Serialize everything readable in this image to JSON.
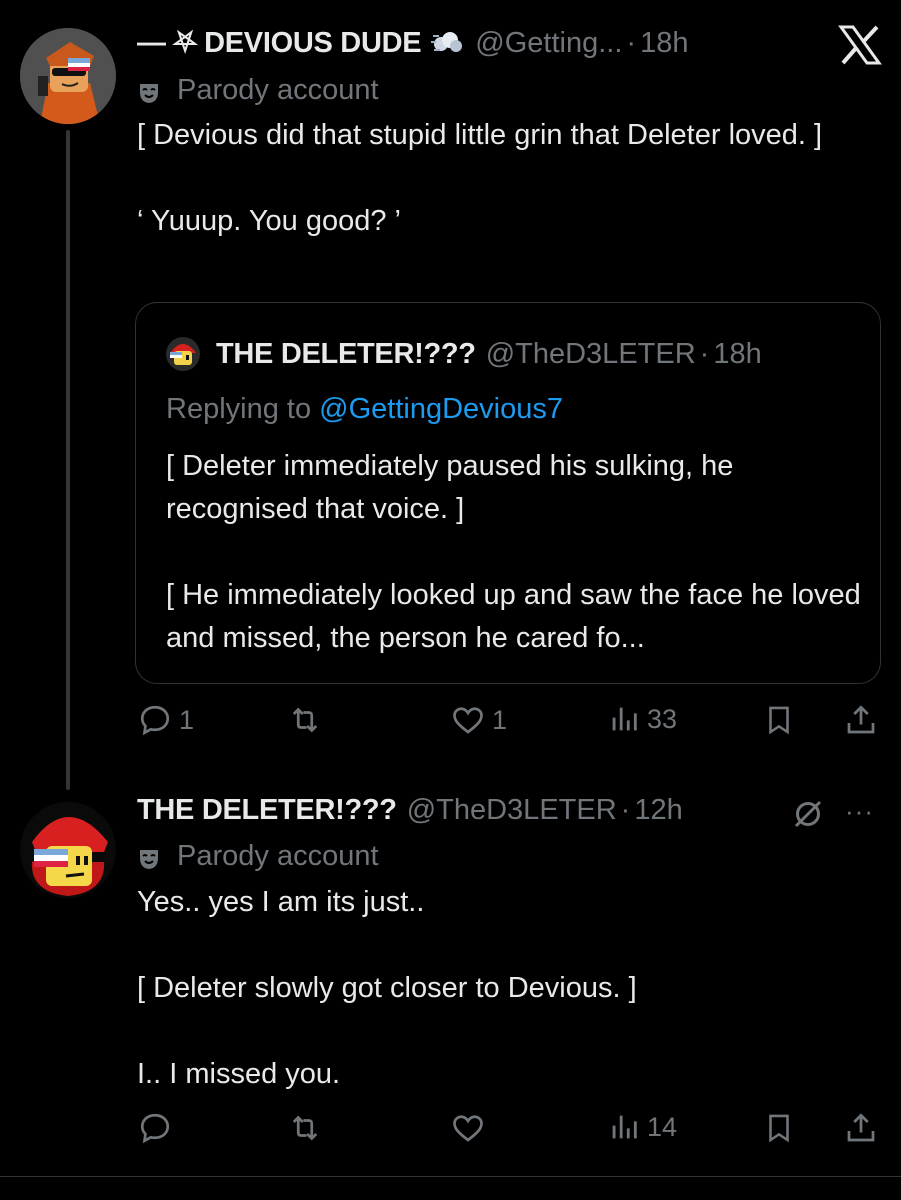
{
  "tweet1": {
    "name": "— ⛧ DEVIOUS DUDE",
    "handle": "@Getting...",
    "time": "18h",
    "parody": "Parody account",
    "lines": [
      "[ Devious did that stupid little grin that Deleter loved. ]",
      "",
      "‘ Yuuup. You good? ’"
    ],
    "quote": {
      "name": "THE DELETER!???",
      "handle": "@TheD3LETER",
      "time": "18h",
      "replying_prefix": "Replying to ",
      "replying_to": "@GettingDevious7",
      "lines": [
        "[ Deleter immediately paused his sulking, he recognised that voice. ]",
        "",
        "[ He immediately looked up and saw the face he loved and missed, the person he cared fo..."
      ]
    },
    "actions": {
      "replies": "1",
      "retweets": "",
      "likes": "1",
      "views": "33"
    }
  },
  "tweet2": {
    "name": "THE DELETER!???",
    "handle": "@TheD3LETER",
    "time": "12h",
    "parody": "Parody account",
    "more": "···",
    "lines": [
      "Yes.. yes I am its just..",
      "",
      "[ Deleter slowly got closer to Devious. ]",
      "",
      "I.. I missed you."
    ],
    "actions": {
      "replies": "",
      "retweets": "",
      "likes": "",
      "views": "14"
    }
  },
  "icons": {
    "close": "x-logo-icon",
    "reply": "reply-icon",
    "retweet": "retweet-icon",
    "like": "heart-icon",
    "views": "views-icon",
    "bookmark": "bookmark-icon",
    "share": "share-icon"
  },
  "colors": {
    "background": "#000000",
    "text": "#e7e9ea",
    "muted": "#71767b",
    "link": "#1d9bf0",
    "border": "#2f3336"
  }
}
